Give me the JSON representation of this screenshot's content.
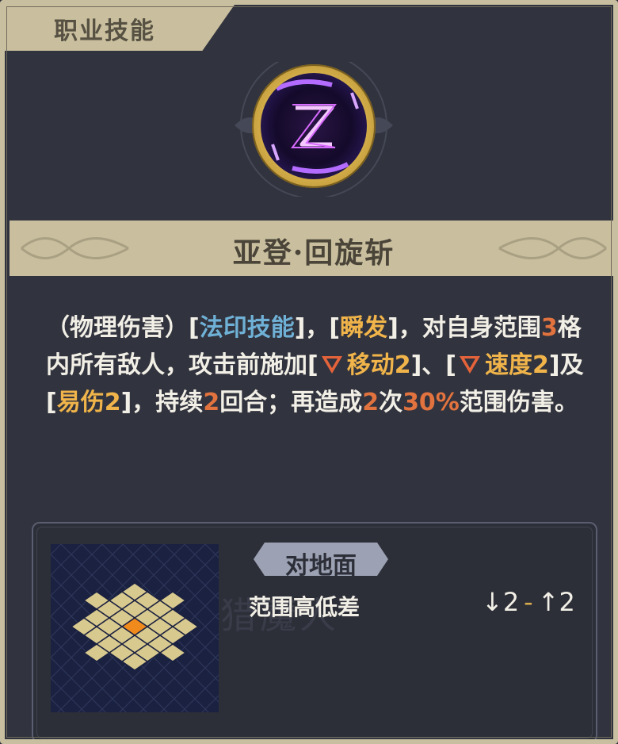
{
  "header": {
    "tab_label": "职业技能"
  },
  "skill": {
    "icon_name": "hourglass-skill-icon",
    "name": "亚登·回旋斩"
  },
  "description": {
    "p1": "（物理伤害）[",
    "tag_magic": "法印技能",
    "p2": "]，[",
    "tag_instant": "瞬发",
    "p3": "]，对自身范围",
    "range_num": "3",
    "p4": "格内所有敌人，攻击前施加[",
    "debuff_move": "移动2",
    "p5": "]、[",
    "debuff_speed": "速度2",
    "p6": "]及[",
    "debuff_vuln": "易伤2",
    "p7": "]，持续",
    "duration_num": "2",
    "p8": "回合；再造成",
    "hits_num": "2",
    "p9": "次",
    "damage_pct": "30%",
    "p10": "范围伤害。"
  },
  "range": {
    "terrain_label": "对地面",
    "height_label": "范围高低差",
    "height_down": "2",
    "height_sep": "-",
    "height_up": "2"
  },
  "colors": {
    "accent_gold": "#c9bf9e",
    "tag_blue": "#6fb1d6",
    "tag_gold": "#f0b44a",
    "number_red": "#e2733e"
  }
}
